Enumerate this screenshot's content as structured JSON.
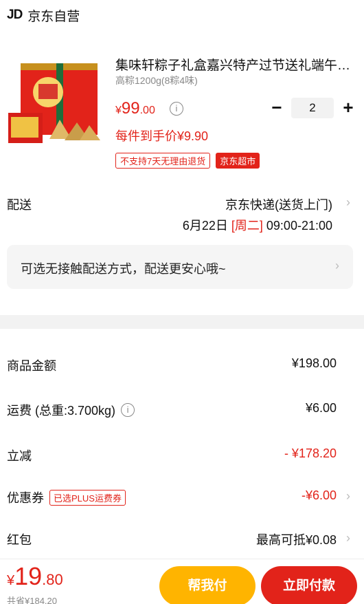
{
  "store": {
    "logo": "JD",
    "name": "京东自营"
  },
  "product": {
    "title": "集味轩粽子礼盒嘉兴特产过节送礼端午节粽子",
    "spec": "高粽1200g(8粽4味)",
    "price": {
      "currency": "¥",
      "integer": "99",
      "decimal": ".00"
    },
    "quantity": "2",
    "minus": "−",
    "plus": "+",
    "hand_price": "每件到手价¥9.90",
    "tags": {
      "return": "不支持7天无理由退货",
      "market": "京东超市"
    }
  },
  "delivery": {
    "label": "配送",
    "method": "京东快递(送货上门)",
    "date": "6月22日",
    "weekday": "[周二]",
    "time": "09:00-21:00",
    "contactless": "可选无接触配送方式，配送更安心哦~"
  },
  "summary": {
    "goods": {
      "label": "商品金额",
      "value": "¥198.00"
    },
    "shipping": {
      "label": "运费 (总重:3.700kg)",
      "value": "¥6.00"
    },
    "discount": {
      "label": "立减",
      "value": "- ¥178.20"
    },
    "coupon": {
      "label": "优惠券",
      "tag": "已选PLUS运费券",
      "value": "-¥6.00"
    },
    "redpacket": {
      "label": "红包",
      "value": "最高可抵¥0.08"
    }
  },
  "bottom": {
    "total": {
      "currency": "¥",
      "integer": "19",
      "decimal": ".80"
    },
    "saved": "共省¥184.20",
    "help_pay": "帮我付",
    "pay": "立即付款"
  },
  "colors": {
    "accent": "#e2231a",
    "help_button": "#ffb400"
  },
  "icons": [
    "info-icon",
    "chevron-right-icon"
  ]
}
